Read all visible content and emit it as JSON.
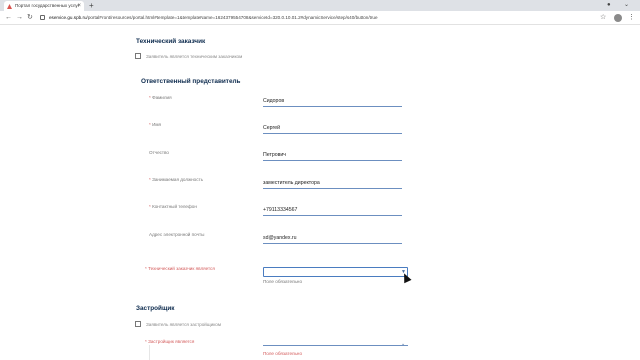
{
  "browser": {
    "tab_title": "Портал государственных услуг",
    "url_host": "eservice.gu.spb.ru",
    "url_path": "/portalFront/resources/portal.html#template=1&templateName=1624379554708&serviceId=320.0.10.01.2#dynamicService/step/s40/button/true"
  },
  "sections": {
    "tech_customer": {
      "title": "Технический заказчик",
      "checkbox_label": "Заявитель является техническим заказчиком"
    },
    "representative": {
      "title": "Ответственный представитель",
      "fields": [
        {
          "label": "Фамилия",
          "required": "*",
          "value": "Сидоров"
        },
        {
          "label": "Имя",
          "required": "*",
          "value": "Сергей"
        },
        {
          "label": "Отчество",
          "required": "",
          "value": "Петрович"
        },
        {
          "label": "Занимаемая должность",
          "required": "*",
          "value": "заместитель директора"
        },
        {
          "label": "Контактный телефон",
          "required": "*",
          "value": "+79113334567"
        },
        {
          "label": "Адрес электронной почты",
          "required": "",
          "value": "sd@yandex.ru"
        }
      ],
      "select_field": {
        "label": "Технический заказчик является",
        "required": "*",
        "error": "Поле обязательно"
      }
    },
    "developer": {
      "title": "Застройщик",
      "checkbox_label": "Заявитель является застройщиком",
      "select_field": {
        "label": "Застройщик является",
        "required": "*",
        "error": "Поле обязательно"
      }
    }
  }
}
